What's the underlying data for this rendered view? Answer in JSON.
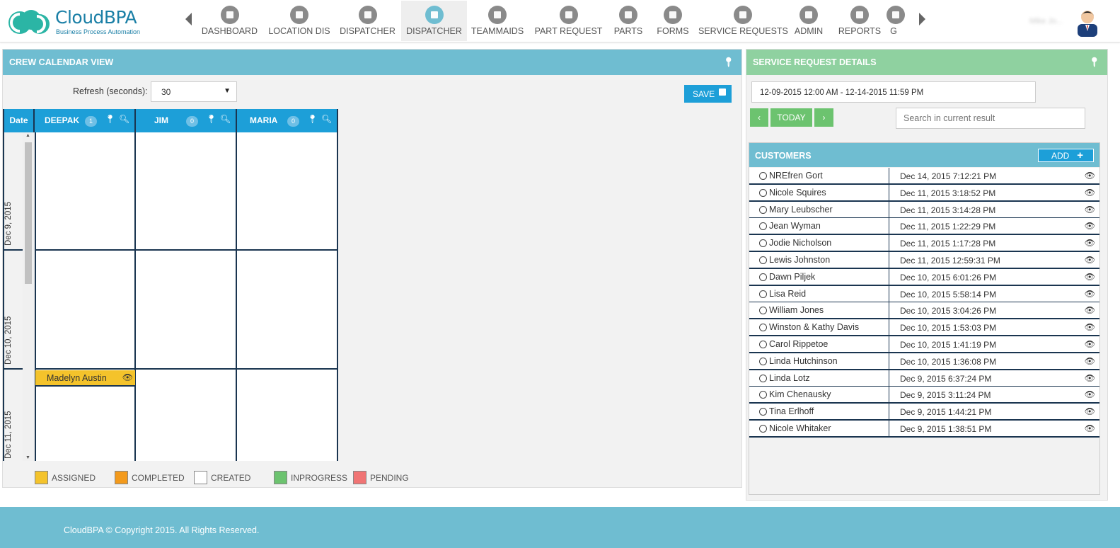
{
  "app": {
    "name": "CloudBPA",
    "tagline": "Business Process Automation",
    "user_name": "Mike Jo..."
  },
  "nav": {
    "items": [
      {
        "label": "DASHBOARD",
        "icon": "dashboard-icon"
      },
      {
        "label": "LOCATION DIS",
        "icon": "location-icon"
      },
      {
        "label": "DISPATCHER",
        "icon": "dispatcher-icon"
      },
      {
        "label": "DISPATCHER",
        "icon": "dispatcher-icon",
        "active": true
      },
      {
        "label": "TEAMMAIDS",
        "icon": "user-icon"
      },
      {
        "label": "PART REQUEST",
        "icon": "mail-icon"
      },
      {
        "label": "PARTS",
        "icon": "wrench-icon"
      },
      {
        "label": "FORMS",
        "icon": "forms-icon"
      },
      {
        "label": "SERVICE REQUESTS",
        "icon": "service-icon"
      },
      {
        "label": "ADMIN",
        "icon": "users-icon"
      },
      {
        "label": "REPORTS",
        "icon": "copy-icon"
      },
      {
        "label": "G",
        "icon": "misc-icon"
      }
    ]
  },
  "crew_panel": {
    "title": "CREW CALENDAR VIEW",
    "refresh_label": "Refresh (seconds):",
    "refresh_value": "30",
    "save_label": "SAVE",
    "date_header": "Date",
    "crews": [
      {
        "name": "DEEPAK",
        "count": "1"
      },
      {
        "name": "JIM",
        "count": "0"
      },
      {
        "name": "MARIA",
        "count": "0"
      }
    ],
    "dates": [
      "Dec 9, 2015",
      "Dec 10, 2015",
      "Dec 11, 2015"
    ],
    "event": {
      "name": "Madelyn Austin",
      "status": "ASSIGNED"
    },
    "legend": [
      {
        "label": "ASSIGNED",
        "color": "#f4c32b"
      },
      {
        "label": "COMPLETED",
        "color": "#f39a1c"
      },
      {
        "label": "CREATED",
        "color": "#ffffff"
      },
      {
        "label": "INPROGRESS",
        "color": "#6cc36f"
      },
      {
        "label": "PENDING",
        "color": "#f07474"
      }
    ]
  },
  "sr_panel": {
    "title": "SERVICE REQUEST DETAILS",
    "date_range": "12-09-2015 12:00 AM - 12-14-2015 11:59 PM",
    "prev_label": "‹",
    "today_label": "TODAY",
    "next_label": "›",
    "search_placeholder": "Search in current result",
    "customers_title": "CUSTOMERS",
    "add_label": "ADD",
    "customers": [
      {
        "name": "NREfren Gort",
        "date": "Dec 14, 2015 7:12:21 PM"
      },
      {
        "name": "Nicole Squires",
        "date": "Dec 11, 2015 3:18:52 PM"
      },
      {
        "name": "Mary Leubscher",
        "date": "Dec 11, 2015 3:14:28 PM"
      },
      {
        "name": "Jean Wyman",
        "date": "Dec 11, 2015 1:22:29 PM"
      },
      {
        "name": "Jodie Nicholson",
        "date": "Dec 11, 2015 1:17:28 PM"
      },
      {
        "name": "Lewis Johnston",
        "date": "Dec 11, 2015 12:59:31 PM"
      },
      {
        "name": "Dawn Piljek",
        "date": "Dec 10, 2015 6:01:26 PM"
      },
      {
        "name": "Lisa Reid",
        "date": "Dec 10, 2015 5:58:14 PM"
      },
      {
        "name": "William Jones",
        "date": "Dec 10, 2015 3:04:26 PM"
      },
      {
        "name": "Winston & Kathy Davis",
        "date": "Dec 10, 2015 1:53:03 PM"
      },
      {
        "name": "Carol Rippetoe",
        "date": "Dec 10, 2015 1:41:19 PM"
      },
      {
        "name": "Linda Hutchinson",
        "date": "Dec 10, 2015 1:36:08 PM"
      },
      {
        "name": "Linda Lotz",
        "date": "Dec 9, 2015 6:37:24 PM"
      },
      {
        "name": "Kim Chenausky",
        "date": "Dec 9, 2015 3:11:24 PM"
      },
      {
        "name": "Tina Erlhoff",
        "date": "Dec 9, 2015 1:44:21 PM"
      },
      {
        "name": "Nicole Whitaker",
        "date": "Dec 9, 2015 1:38:51 PM"
      }
    ]
  },
  "footer": {
    "text": "CloudBPA © Copyright 2015. All Rights Reserved."
  },
  "colors": {
    "header_blue": "#6fbdd1",
    "header_green": "#8fd1a0",
    "button_blue": "#1d9fd8",
    "button_green": "#6cc36f"
  }
}
